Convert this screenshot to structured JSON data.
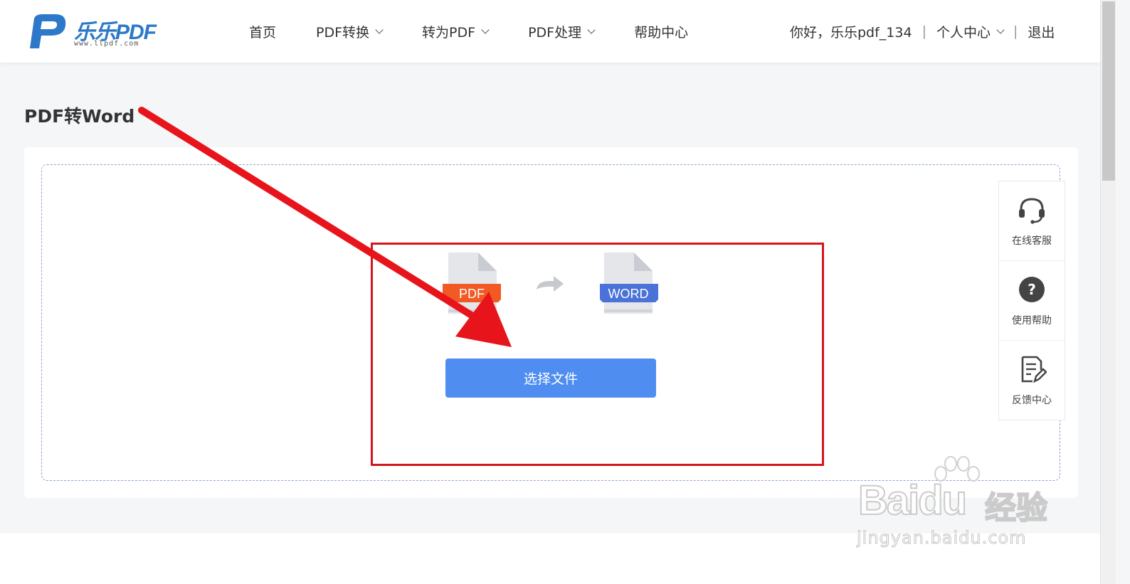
{
  "brand": {
    "name": "乐乐PDF",
    "url": "www.llpdf.com",
    "accent": "#2d78c8"
  },
  "nav": [
    {
      "label": "首页",
      "dropdown": false
    },
    {
      "label": "PDF转换",
      "dropdown": true
    },
    {
      "label": "转为PDF",
      "dropdown": true
    },
    {
      "label": "PDF处理",
      "dropdown": true
    },
    {
      "label": "帮助中心",
      "dropdown": false
    }
  ],
  "user": {
    "greeting": "你好，乐乐pdf_134",
    "separator": "|",
    "account_label": "个人中心",
    "logout_label": "退出"
  },
  "page": {
    "title": "PDF转Word"
  },
  "converter": {
    "source_label": "PDF",
    "source_color": "#f15a24",
    "target_label": "WORD",
    "target_color": "#4a72d9",
    "select_button_label": "选择文件",
    "button_color": "#4f8ef0"
  },
  "annotation": {
    "color": "#d4151b"
  },
  "side_panel": [
    {
      "label": "在线客服",
      "icon": "headset-icon"
    },
    {
      "label": "使用帮助",
      "icon": "help-icon"
    },
    {
      "label": "反馈中心",
      "icon": "feedback-icon"
    }
  ],
  "watermark": {
    "brand": "Baidu",
    "suffix": "经验",
    "url": "jingyan.baidu.com"
  }
}
